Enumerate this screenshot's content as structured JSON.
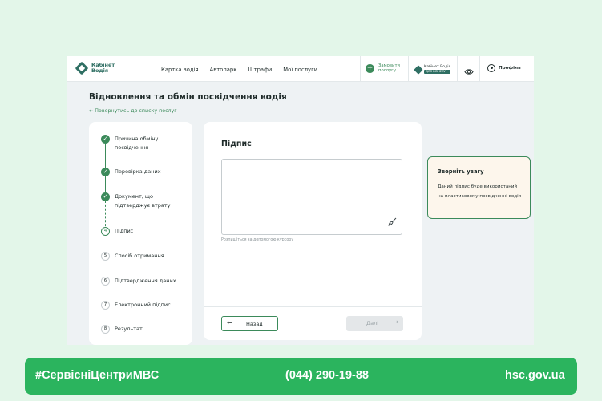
{
  "app": {
    "logo_text": "Кабінет Водія",
    "nav": [
      "Картка водія",
      "Автопарк",
      "Штрафи",
      "Мої послуги"
    ],
    "order_service": "Замовити послугу",
    "business_logo": "Кабінет Водія",
    "business_badge": "ДЛЯ БІЗНЕСУ",
    "profile": "Профіль"
  },
  "page": {
    "title": "Відновлення та обмін посвідчення водія",
    "back_link": "← Повернутись до списку послуг"
  },
  "steps": [
    {
      "num": "✓",
      "label": "Причина обміну посвідчення",
      "state": "done"
    },
    {
      "num": "✓",
      "label": "Перевірка даних",
      "state": "done"
    },
    {
      "num": "✓",
      "label": "Документ, що підтверджує втрату",
      "state": "done"
    },
    {
      "num": "4",
      "label": "Підпис",
      "state": "current"
    },
    {
      "num": "5",
      "label": "Спосіб отримання",
      "state": "todo"
    },
    {
      "num": "6",
      "label": "Підтвердження даних",
      "state": "todo"
    },
    {
      "num": "7",
      "label": "Електронний підпис",
      "state": "todo"
    },
    {
      "num": "8",
      "label": "Результат",
      "state": "todo"
    }
  ],
  "form": {
    "title": "Підпис",
    "hint": "Розпишіться за допомогою курсору",
    "back_button": "Назад",
    "next_button": "Далі",
    "back_arrow": "←",
    "next_arrow": "→"
  },
  "notice": {
    "title": "Зверніть увагу",
    "body": "Даний підпис буде використаний на пластиковому посвідченні водія"
  },
  "banner": {
    "hashtag": "#СервісніЦентриМВС",
    "phone": "(044) 290-19-88",
    "site": "hsc.gov.ua"
  },
  "colors": {
    "accent": "#3b8a5a",
    "brand_dark": "#2f6f63",
    "banner": "#2bb45e",
    "notice_bg": "#fdf6ec"
  }
}
